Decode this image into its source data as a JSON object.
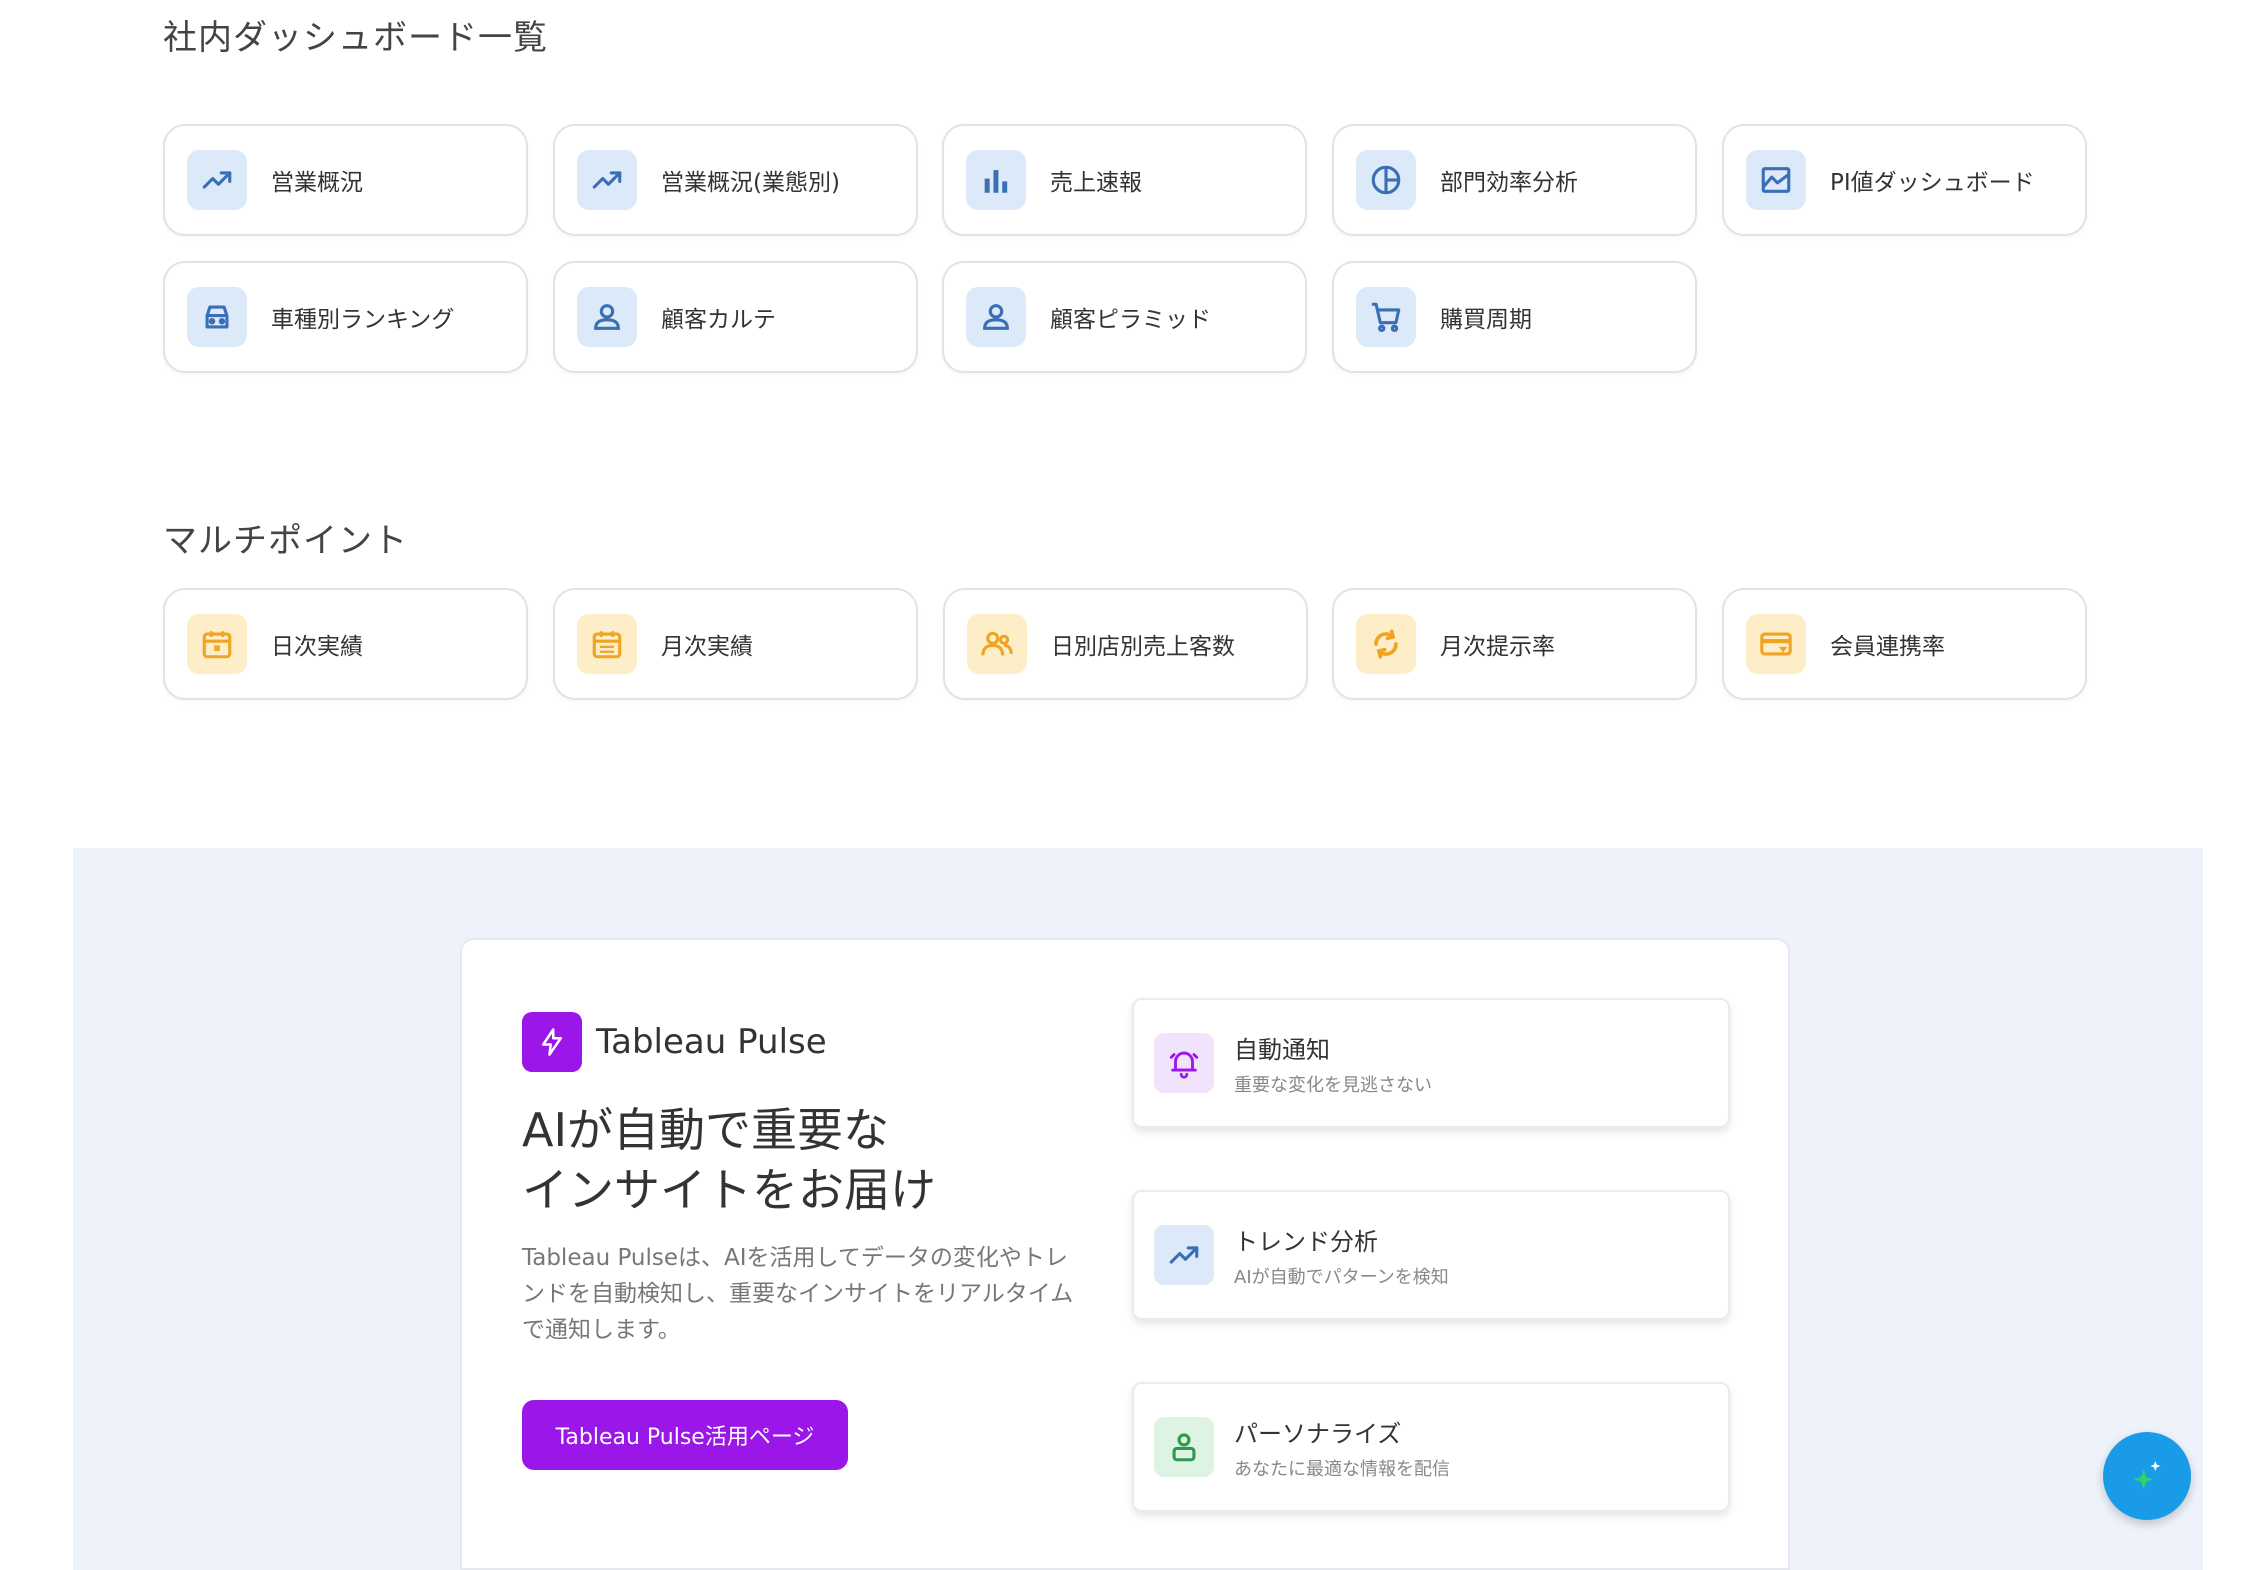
{
  "section1": {
    "title": "社内ダッシュボード一覧",
    "cards": [
      {
        "label": "営業概況",
        "icon": "trending-up-icon"
      },
      {
        "label": "営業概況(業態別)",
        "icon": "trending-up-icon"
      },
      {
        "label": "売上速報",
        "icon": "bar-chart-icon"
      },
      {
        "label": "部門効率分析",
        "icon": "pie-chart-icon"
      },
      {
        "label": "PI値ダッシュボード",
        "icon": "area-chart-icon"
      },
      {
        "label": "車種別ランキング",
        "icon": "car-icon"
      },
      {
        "label": "顧客カルテ",
        "icon": "user-icon"
      },
      {
        "label": "顧客ピラミッド",
        "icon": "user-icon"
      },
      {
        "label": "購買周期",
        "icon": "cart-icon"
      }
    ]
  },
  "section2": {
    "title": "マルチポイント",
    "cards": [
      {
        "label": "日次実績",
        "icon": "calendar-icon"
      },
      {
        "label": "月次実績",
        "icon": "calendar-icon"
      },
      {
        "label": "日別店別売上客数",
        "icon": "users-icon"
      },
      {
        "label": "月次提示率",
        "icon": "refresh-icon"
      },
      {
        "label": "会員連携率",
        "icon": "card-icon"
      }
    ]
  },
  "pulse": {
    "brand": "Tableau Pulse",
    "headline_line1": "AIが自動で重要な",
    "headline_line2": "インサイトをお届け",
    "description": "Tableau Pulseは、AIを活用してデータの変化やトレンドを自動検知し、重要なインサイトをリアルタイムで通知します。",
    "cta": "Tableau Pulse活用ページ",
    "features": [
      {
        "title": "自動通知",
        "subtitle": "重要な変化を見逃さない",
        "icon": "bell-icon"
      },
      {
        "title": "トレンド分析",
        "subtitle": "AIが自動でパターンを検知",
        "icon": "trending-up-icon"
      },
      {
        "title": "パーソナライズ",
        "subtitle": "あなたに最適な情報を配信",
        "icon": "user-icon"
      }
    ]
  },
  "colors": {
    "accent": "#9b16e8",
    "blue_icon": "#3a6fb5",
    "yellow_icon": "#f0a424",
    "fab": "#1a9be8"
  }
}
